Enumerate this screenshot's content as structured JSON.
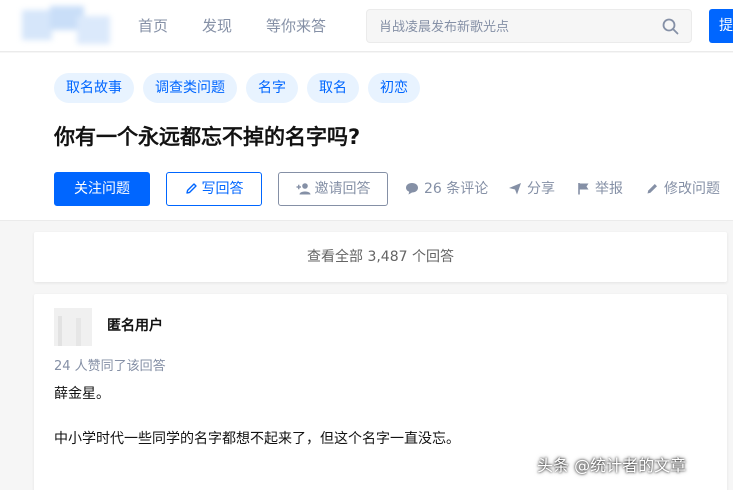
{
  "nav": {
    "items": [
      "首页",
      "发现",
      "等你来答"
    ],
    "search_placeholder": "肖战凌晨发布新歌光点",
    "ask_button": "提"
  },
  "question": {
    "tags": [
      "取名故事",
      "调查类问题",
      "名字",
      "取名",
      "初恋"
    ],
    "title": "你有一个永远都忘不掉的名字吗?",
    "follow_button": "关注问题",
    "write_button": "写回答",
    "invite_button": "邀请回答",
    "comments": "26 条评论",
    "share": "分享",
    "report": "举报",
    "edit": "修改问题"
  },
  "answers": {
    "view_all": "查看全部 3,487 个回答"
  },
  "answer": {
    "author": "匿名用户",
    "votes": "24 人赞同了该回答",
    "paragraphs": [
      "薛金星。",
      "中小学时代一些同学的名字都想不起来了，但这个名字一直没忘。"
    ]
  },
  "watermark": "头条 @统计者的文章",
  "colors": {
    "brand_blue": "#0066ff",
    "tag_bg": "#e8f3ff",
    "muted_gray": "#8590a6"
  },
  "icons": [
    "search-icon",
    "pen-icon",
    "add-user-icon",
    "comment-icon",
    "share-icon",
    "flag-icon",
    "pencil-icon"
  ]
}
